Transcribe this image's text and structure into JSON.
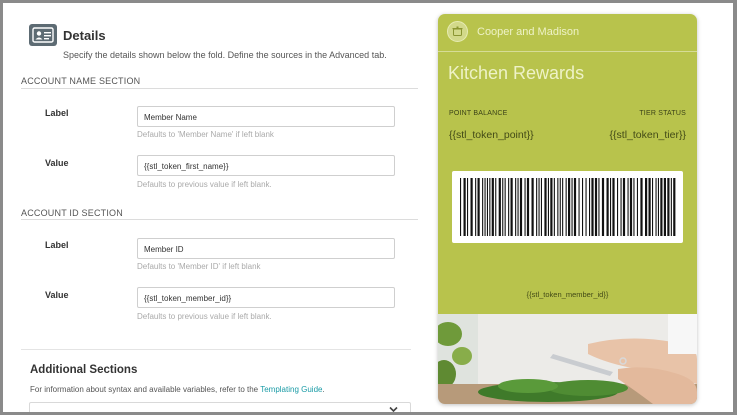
{
  "details": {
    "title": "Details",
    "description": "Specify the details shown below the fold. Define the sources in the Advanced tab."
  },
  "account_name_section": {
    "heading": "ACCOUNT NAME SECTION",
    "label_field": {
      "label": "Label",
      "value": "Member Name",
      "help": "Defaults to 'Member Name' if left blank"
    },
    "value_field": {
      "label": "Value",
      "value": "{{stl_token_first_name}}",
      "help": "Defaults to previous value if left blank."
    }
  },
  "account_id_section": {
    "heading": "ACCOUNT ID SECTION",
    "label_field": {
      "label": "Label",
      "value": "Member ID",
      "help": "Defaults to 'Member ID' if left blank"
    },
    "value_field": {
      "label": "Value",
      "value": "{{stl_token_member_id}}",
      "help": "Defaults to previous value if left blank."
    }
  },
  "additional_sections": {
    "title": "Additional Sections",
    "description_prefix": "For information about syntax and available variables, refer to the ",
    "link_text": "Templating Guide",
    "description_suffix": "."
  },
  "pass": {
    "organization": "Cooper and Madison",
    "title": "Kitchen Rewards",
    "point_label": "POINT BALANCE",
    "point_value": "{{stl_token_point}}",
    "tier_label": "TIER STATUS",
    "tier_value": "{{stl_token_tier}}",
    "member_value": "{{stl_token_member_id}}",
    "background_color": "#b8c34c"
  },
  "icons": {
    "details": "id-card-icon",
    "pass_logo": "pot-icon",
    "select": "chevron-down-icon"
  }
}
